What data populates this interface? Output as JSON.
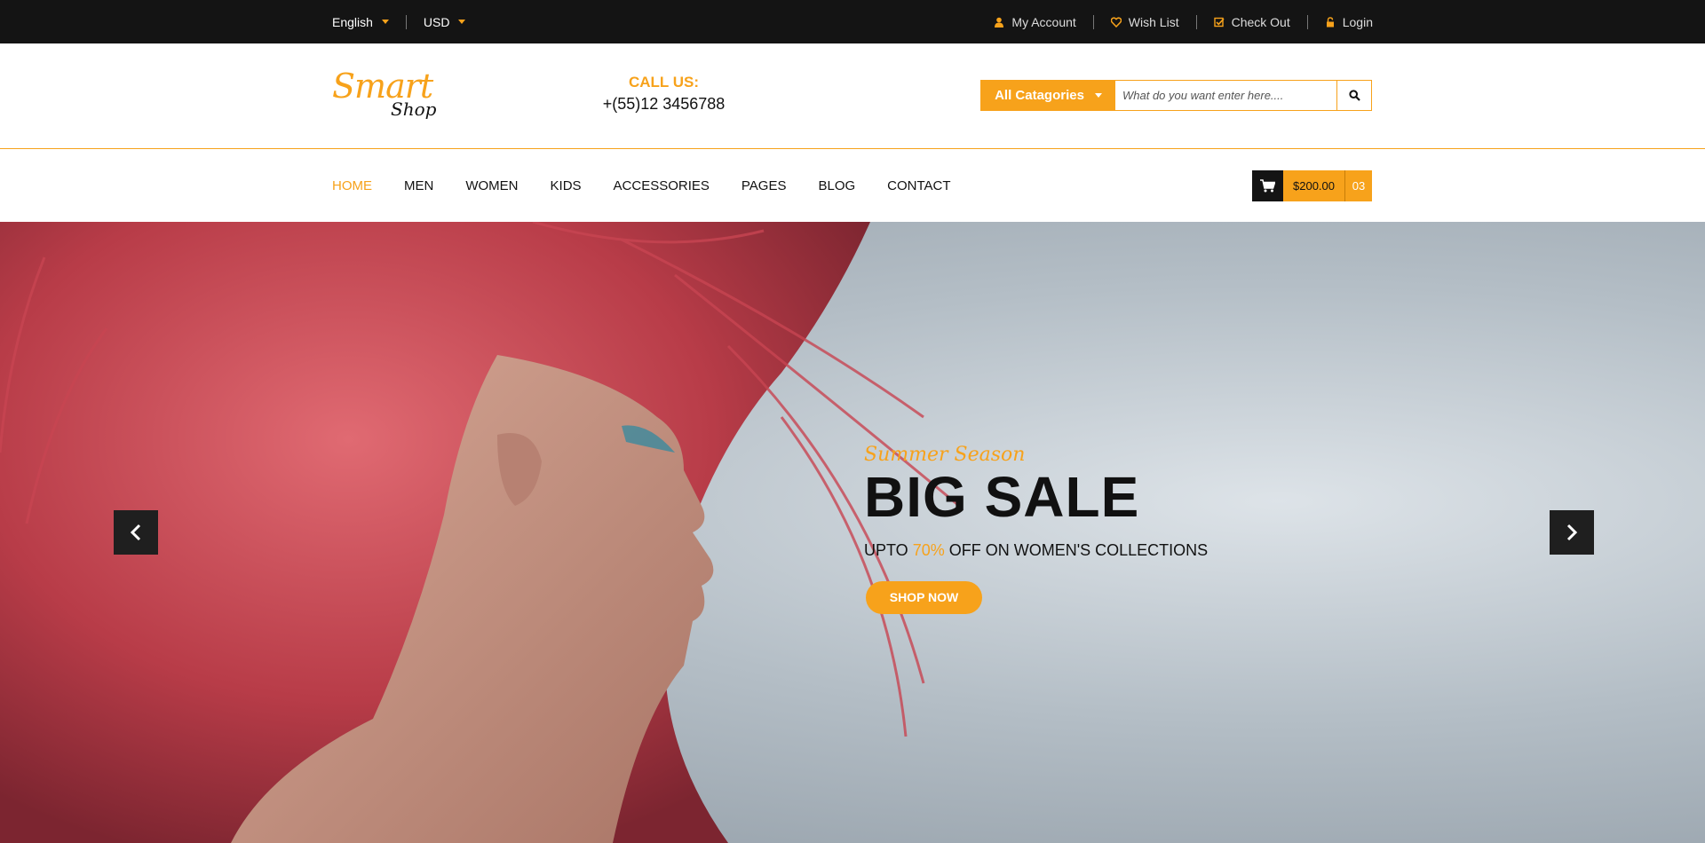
{
  "topbar": {
    "language": "English",
    "currency": "USD",
    "links": [
      "My Account",
      "Wish List",
      "Check Out",
      "Login"
    ]
  },
  "logo": {
    "line1": "Smart",
    "line2": "Shop"
  },
  "contact": {
    "label": "CALL US:",
    "phone": "+(55)12 3456788"
  },
  "search": {
    "category": "All Catagories",
    "placeholder": "What do you want enter here...."
  },
  "nav": {
    "items": [
      "HOME",
      "MEN",
      "WOMEN",
      "KIDS",
      "ACCESSORIES",
      "PAGES",
      "BLOG",
      "CONTACT"
    ],
    "active": "HOME"
  },
  "cart": {
    "total": "$200.00",
    "count": "03"
  },
  "hero": {
    "kicker": "Summer Season",
    "title": "BIG SALE",
    "subtitle_pre": "UPTO ",
    "subtitle_highlight": "70%",
    "subtitle_post": " OFF ON WOMEN'S COLLECTIONS",
    "cta": "SHOP NOW"
  },
  "colors": {
    "accent": "#f7a21b",
    "dark": "#141414"
  },
  "icons": [
    "user-icon",
    "heart-icon",
    "check-icon",
    "lock-icon",
    "search-icon",
    "cart-icon",
    "chevron-left-icon",
    "chevron-right-icon"
  ]
}
